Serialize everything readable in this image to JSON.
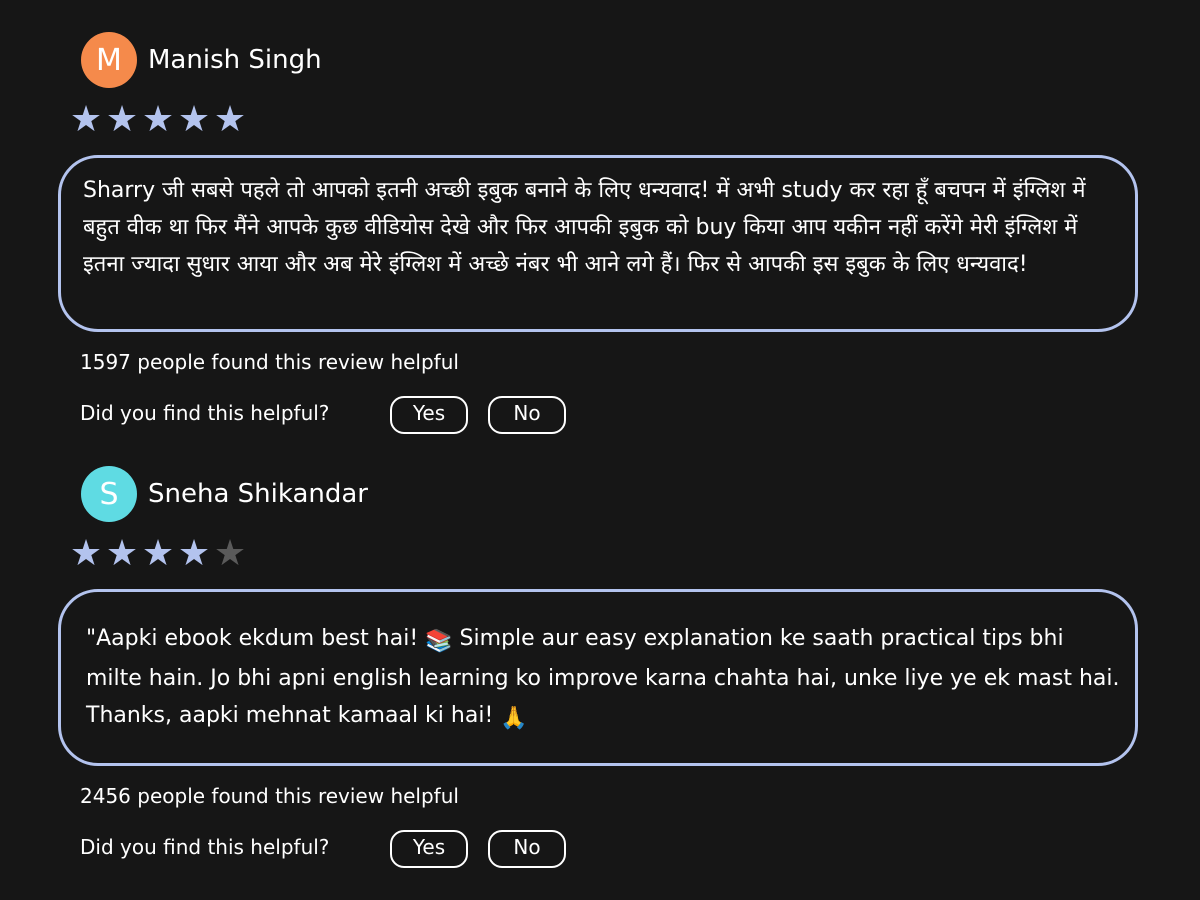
{
  "reviews": [
    {
      "avatar_letter": "M",
      "avatar_color": "#f58a4b",
      "name": "Manish Singh",
      "rating": 5,
      "rating_max": 5,
      "text": "Sharry जी सबसे पहले तो आपको इतनी अच्छी इबुक बनाने के लिए धन्यवाद! में अभी study कर रहा हूँ बचपन में इंग्लिश में बहुत वीक था फिर मैंने आपके कुछ वीडियोस देखे और फिर आपकी इबुक को buy किया आप यकीन नहीं करेंगे मेरी इंग्लिश में इतना ज्यादा सुधार आया और अब मेरे इंग्लिश में अच्छे नंबर भी आने लगे हैं। फिर से आपकी इस इबुक के लिए धन्यवाद!",
      "helpful_count": "1597 people found this review helpful",
      "helpful_question": "Did you find this helpful?",
      "yes_label": "Yes",
      "no_label": "No"
    },
    {
      "avatar_letter": "S",
      "avatar_color": "#5fdbe3",
      "name": "Sneha Shikandar",
      "rating": 4,
      "rating_max": 5,
      "text_before_books": "\"Aapki ebook ekdum best hai! ",
      "books_emoji": "📚",
      "text_after_books": " Simple aur easy explanation ke saath practical tips bhi milte hain. Jo bhi apni english learning ko improve karna chahta hai, unke liye ye ek mast hai. Thanks, aapki mehnat kamaal ki hai! ",
      "pray_emoji": "🙏",
      "helpful_count": "2456 people found this review helpful",
      "helpful_question": "Did you find this helpful?",
      "yes_label": "Yes",
      "no_label": "No"
    }
  ],
  "colors": {
    "background": "#161616",
    "accent": "#b3c3ee",
    "star_empty": "#5a5a5a"
  }
}
